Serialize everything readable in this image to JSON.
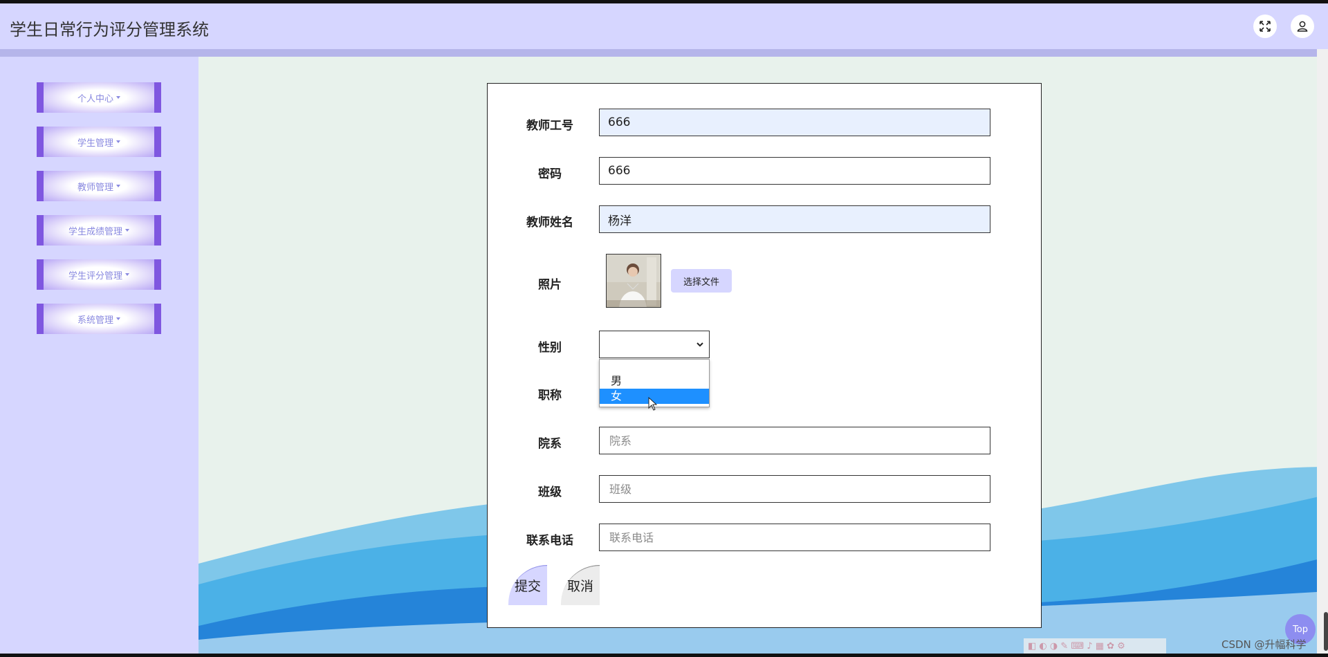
{
  "header": {
    "title": "学生日常行为评分管理系统",
    "fullscreen_icon": "fullscreen-icon",
    "user_icon": "user-icon"
  },
  "sidebar": {
    "items": [
      {
        "label": "个人中心"
      },
      {
        "label": "学生管理"
      },
      {
        "label": "教师管理"
      },
      {
        "label": "学生成绩管理"
      },
      {
        "label": "学生评分管理"
      },
      {
        "label": "系统管理"
      }
    ]
  },
  "form": {
    "teacher_id": {
      "label": "教师工号",
      "value": "666"
    },
    "password": {
      "label": "密码",
      "value": "666"
    },
    "teacher_name": {
      "label": "教师姓名",
      "value": "杨洋"
    },
    "photo": {
      "label": "照片",
      "button": "选择文件"
    },
    "gender": {
      "label": "性别",
      "value": "",
      "options": [
        "男",
        "女"
      ],
      "highlighted": "女"
    },
    "title": {
      "label": "职称"
    },
    "department": {
      "label": "院系",
      "placeholder": "院系"
    },
    "class": {
      "label": "班级",
      "placeholder": "班级"
    },
    "phone": {
      "label": "联系电话",
      "placeholder": "联系电话"
    },
    "submit": "提交",
    "cancel": "取消"
  },
  "footer": {
    "top_button": "Top",
    "watermark": "CSDN @升幅科学"
  },
  "colors": {
    "header_bg": "#d6d6ff",
    "menu_accent": "#7f57e0",
    "content_bg": "#e8f2ec",
    "option_highlight": "#1e90ff"
  }
}
